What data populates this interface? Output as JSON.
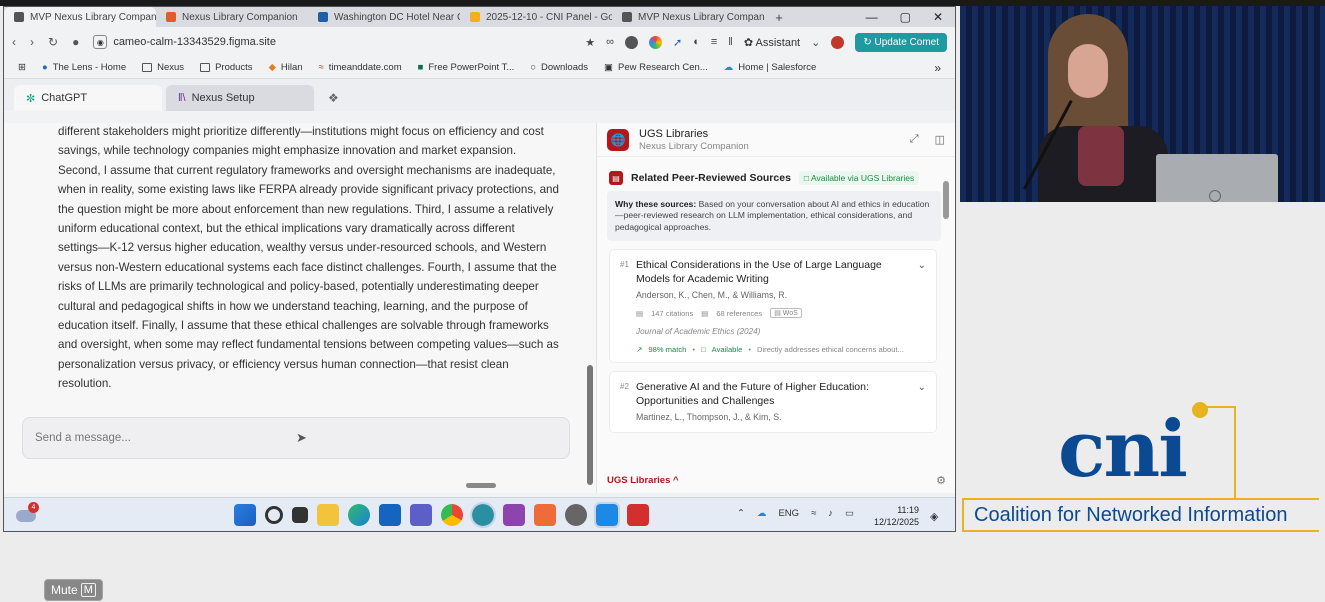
{
  "browser": {
    "tabs": [
      {
        "label": "MVP Nexus Library Companic",
        "color": "#555555",
        "active": true
      },
      {
        "label": "Nexus Library Companion",
        "color": "#e05b2d"
      },
      {
        "label": "Washington DC Hotel Near C",
        "color": "#1f5fa8"
      },
      {
        "label": "2025-12-10 - CNI Panel - Go",
        "color": "#f2b01e"
      },
      {
        "label": "MVP Nexus Library Companic",
        "color": "#555555"
      }
    ],
    "new_tab": "+",
    "window_controls": [
      "—",
      "▢",
      "✕"
    ],
    "url": "cameo-calm-13343529.figma.site",
    "assistant_label": "Assistant",
    "update_label": "Update Comet",
    "bookmarks": [
      "The Lens - Home",
      "Nexus",
      "Products",
      "Hilan",
      "timeanddate.com",
      "Free PowerPoint T...",
      "Downloads",
      "Pew Research Cen...",
      "Home | Salesforce"
    ],
    "bookmarks_more": "»"
  },
  "app_tabs": [
    {
      "label": "ChatGPT"
    },
    {
      "label": "Nexus Setup"
    }
  ],
  "chat": {
    "lines": [
      "different stakeholders might prioritize differently—institutions might focus on efficiency and cost",
      "savings, while technology companies might emphasize innovation and market expansion.",
      "Second, I assume that current regulatory frameworks and oversight mechanisms are inadequate,",
      "when in reality, some existing laws like FERPA already provide significant privacy protections, and",
      "the question might be more about enforcement than new regulations. Third, I assume a relatively",
      "uniform educational context, but the ethical implications vary dramatically across different",
      "settings—K-12 versus higher education, wealthy versus under-resourced schools, and Western",
      "versus non-Western educational systems each face distinct challenges. Fourth, I assume that the",
      "risks of LLMs are primarily technological and policy-based, potentially underestimating deeper",
      "cultural and pedagogical shifts in how we understand teaching, learning, and the purpose of",
      "education itself. Finally, I assume that these ethical challenges are solvable through frameworks",
      "and oversight, when some may reflect fundamental tensions between competing values—such as",
      "personalization versus privacy, or efficiency versus human connection—that resist clean",
      "resolution."
    ],
    "input_placeholder": "Send a message..."
  },
  "panel": {
    "title": "UGS Libraries",
    "subtitle": "Nexus Library Companion",
    "section_title": "Related Peer-Reviewed Sources",
    "availability_badge": "Available via UGS Libraries",
    "why_label": "Why these sources:",
    "why_text": "Based on your conversation about AI and ethics in education—peer-reviewed research on LLM implementation, ethical considerations, and pedagogical approaches.",
    "sources": [
      {
        "num": "#1",
        "title": "Ethical Considerations in the Use of Large Language Models for Academic Writing",
        "authors": "Anderson, K., Chen, M., & Williams, R.",
        "citations": "147 citations",
        "references": "68 references",
        "index": "WoS",
        "journal": "Journal of Academic Ethics (2024)",
        "match": "98% match",
        "availability": "Available",
        "note": "Directly addresses ethical concerns about..."
      },
      {
        "num": "#2",
        "title": "Generative AI and the Future of Higher Education: Opportunities and Challenges",
        "authors": "Martinez, L., Thompson, J., & Kim, S."
      }
    ],
    "footer_label": "UGS Libraries",
    "footer_caret": "^"
  },
  "taskbar": {
    "weather_badge": "4",
    "tray_lang": "ENG",
    "time": "11:19",
    "date": "12/12/2025"
  },
  "cni": {
    "logo_text": "cni",
    "tagline": "Coalition for Networked Information",
    "blue": "#0b4a92",
    "gold": "#e6b321"
  },
  "mute": {
    "label": "Mute",
    "key": "M"
  }
}
